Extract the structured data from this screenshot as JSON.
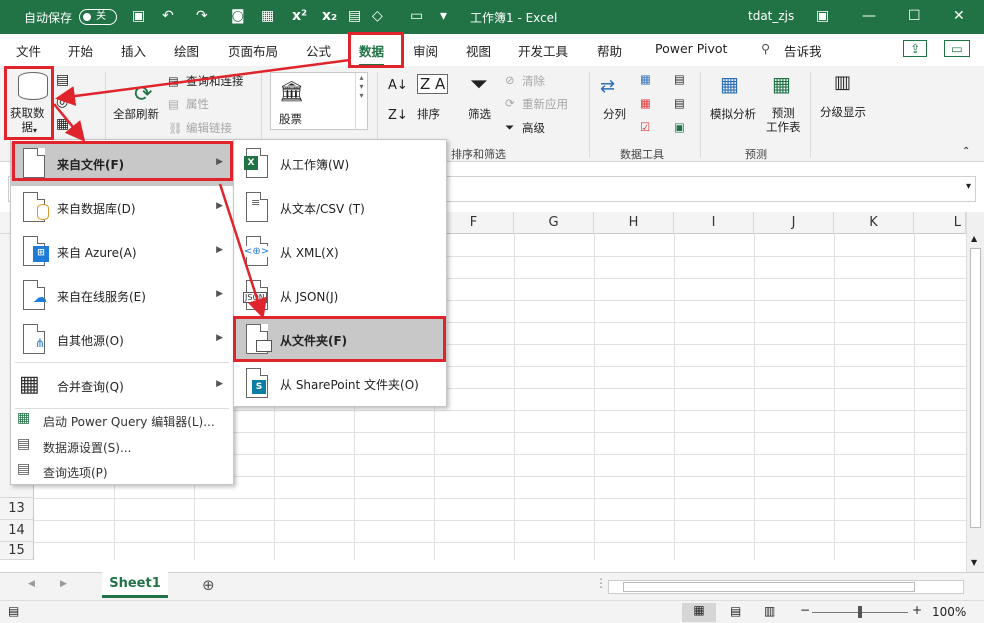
{
  "titlebar": {
    "autosave_label": "自动保存",
    "toggle_state": "关",
    "title": "工作簿1 - Excel",
    "user": "tdat_zjs",
    "bg": "#217346"
  },
  "tabs": [
    "文件",
    "开始",
    "插入",
    "绘图",
    "页面布局",
    "公式",
    "数据",
    "审阅",
    "视图",
    "开发工具",
    "帮助",
    "Power Pivot",
    "告诉我"
  ],
  "ribbon": {
    "get_data": "获取数\n据",
    "refresh_all": "全部刷新",
    "query_connect": "查询和连接",
    "properties": "属性",
    "edit_links": "编辑链接",
    "stocks": "股票",
    "sort": "排序",
    "filter": "筛选",
    "clear": "清除",
    "reapply": "重新应用",
    "advanced": "高级",
    "sort_filter_group": "排序和筛选",
    "text_to_columns": "分列",
    "data_tools_group": "数据工具",
    "whatif": "模拟分析",
    "forecast_sheet": "预测\n工作表",
    "forecast_group": "预测",
    "outline": "分级显示"
  },
  "columns": [
    "F",
    "G",
    "H",
    "I",
    "J",
    "K",
    "L"
  ],
  "rows": [
    "13",
    "14",
    "15"
  ],
  "menu1": {
    "items": [
      {
        "label": "来自文件(F)",
        "name": "from-file"
      },
      {
        "label": "来自数据库(D)",
        "name": "from-database"
      },
      {
        "label": "来自 Azure(A)",
        "name": "from-azure"
      },
      {
        "label": "来自在线服务(E)",
        "name": "from-online-services"
      },
      {
        "label": "自其他源(O)",
        "name": "from-other-sources"
      },
      {
        "label": "合并查询(Q)",
        "name": "combine-queries"
      }
    ],
    "small": [
      {
        "label": "启动 Power Query 编辑器(L)...",
        "name": "launch-power-query-editor"
      },
      {
        "label": "数据源设置(S)...",
        "name": "data-source-settings"
      },
      {
        "label": "查询选项(P)",
        "name": "query-options"
      }
    ]
  },
  "menu2": {
    "items": [
      {
        "label": "从工作簿(W)",
        "name": "from-workbook"
      },
      {
        "label": "从文本/CSV (T)",
        "name": "from-text-csv"
      },
      {
        "label": "从 XML(X)",
        "name": "from-xml"
      },
      {
        "label": "从 JSON(J)",
        "name": "from-json"
      },
      {
        "label": "从文件夹(F)",
        "name": "from-folder"
      },
      {
        "label": "从 SharePoint 文件夹(O)",
        "name": "from-sharepoint-folder"
      }
    ]
  },
  "sheet": {
    "tab": "Sheet1",
    "zoom": "100%"
  },
  "colors": {
    "accent": "#217346",
    "highlight": "#e0242c",
    "selected": "#c8c8c8"
  }
}
